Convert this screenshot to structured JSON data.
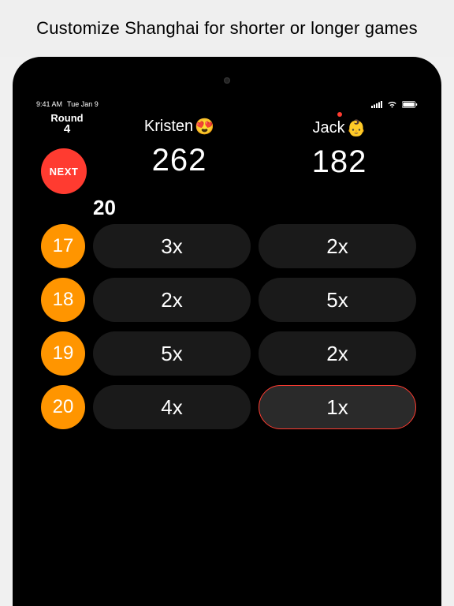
{
  "caption": "Customize Shanghai for shorter or longer games",
  "statusbar": {
    "time": "9:41 AM",
    "date": "Tue Jan 9"
  },
  "round": {
    "label": "Round",
    "number": "4"
  },
  "next_label": "NEXT",
  "current_target": "20",
  "players": [
    {
      "name": "Kristen",
      "emoji": "😍",
      "score": "262",
      "is_turn": false
    },
    {
      "name": "Jack",
      "emoji": "👶",
      "score": "182",
      "is_turn": true
    }
  ],
  "rows": [
    {
      "number": "17",
      "p1": "3x",
      "p2": "2x",
      "active": null
    },
    {
      "number": "18",
      "p1": "2x",
      "p2": "5x",
      "active": null
    },
    {
      "number": "19",
      "p1": "5x",
      "p2": "2x",
      "active": null
    },
    {
      "number": "20",
      "p1": "4x",
      "p2": "1x",
      "active": "p2"
    }
  ],
  "colors": {
    "accent_red": "#ff3b30",
    "accent_orange": "#ff9500",
    "pill_bg": "#1a1a1a",
    "pill_active_bg": "#2a2a2a"
  }
}
